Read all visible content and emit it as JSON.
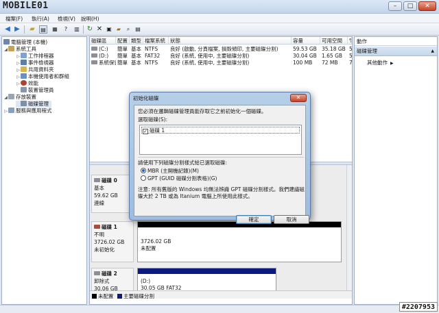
{
  "window": {
    "logo_text": "MOBILE01"
  },
  "menu": [
    "檔案(F)",
    "執行(A)",
    "檢視(V)",
    "說明(H)"
  ],
  "tree": [
    {
      "label": "電腦管理 (本機)",
      "depth": 0,
      "icon": "computer-icon"
    },
    {
      "label": "系統工具",
      "depth": 1,
      "icon": "tools-icon"
    },
    {
      "label": "工作排程器",
      "depth": 2,
      "icon": "task-scheduler-icon"
    },
    {
      "label": "事件檢視器",
      "depth": 2,
      "icon": "event-viewer-icon"
    },
    {
      "label": "共用資料夾",
      "depth": 2,
      "icon": "shared-folder-icon"
    },
    {
      "label": "本機使用者和群組",
      "depth": 2,
      "icon": "users-groups-icon"
    },
    {
      "label": "效能",
      "depth": 2,
      "icon": "performance-icon"
    },
    {
      "label": "裝置管理員",
      "depth": 2,
      "icon": "device-manager-icon"
    },
    {
      "label": "存放裝置",
      "depth": 1,
      "icon": "storage-icon"
    },
    {
      "label": "磁碟管理",
      "depth": 2,
      "icon": "disk-management-icon"
    },
    {
      "label": "服務與應用程式",
      "depth": 1,
      "icon": "services-icon"
    }
  ],
  "volumes": {
    "headers": [
      "磁碟區",
      "配置",
      "類型",
      "檔案系統",
      "狀態",
      "容量",
      "可用空間",
      "%"
    ],
    "rows": [
      [
        "(C:)",
        "簡單",
        "基本",
        "NTFS",
        "良好 (啟動, 分頁檔案, 損毀傾印, 主要磁碟分割)",
        "59.53 GB",
        "35.18 GB",
        "5"
      ],
      [
        "(D:)",
        "簡單",
        "基本",
        "FAT32",
        "良好 (系統, 使用中, 主要磁碟分割)",
        "30.04 GB",
        "1.65 GB",
        "5"
      ],
      [
        "系統保留",
        "簡單",
        "基本",
        "NTFS",
        "良好 (系統, 使用中, 主要磁碟分割)",
        "100 MB",
        "72 MB",
        "7"
      ]
    ]
  },
  "disks": [
    {
      "name": "磁碟 0",
      "type": "基本",
      "size": "59.62 GB",
      "status": "連線",
      "partition": ""
    },
    {
      "name": "磁碟 1",
      "type": "不明",
      "size": "3726.02 GB",
      "status": "未初始化",
      "partition": "3726.02 GB",
      "partition_status": "未配置"
    },
    {
      "name": "磁碟 2",
      "type": "卸除式",
      "size": "30.06 GB",
      "status": "",
      "partition": "(D:)",
      "partition_detail": "30.05 GB FAT32"
    }
  ],
  "legend": [
    {
      "label": "未配置",
      "color": "#000000"
    },
    {
      "label": "主要磁碟分割",
      "color": "#0a1a80"
    }
  ],
  "actions": {
    "header": "動作",
    "section": "磁碟管理",
    "more": "其他動作"
  },
  "dialog": {
    "title": "初始化磁碟",
    "intro": "您必須在邏輯磁碟管理員能存取它之前初始化一個磁碟。",
    "select_label": "選取磁碟(S):",
    "disk_item": "磁碟 1",
    "style_label": "請使用下列磁碟分割樣式給已選取磁碟:",
    "option_mbr": "MBR (主開機記錄)(M)",
    "option_gpt": "GPT (GUID 磁碟分割表格)(G)",
    "note_line1": "注意: 所有舊版的 Windows 均無法辨識 GPT 磁碟分割樣式。我們建議磁",
    "note_line2": "碟大於 2 TB 或為 Itanium 電腦上所使用此樣式。",
    "ok": "確定",
    "cancel": "取消"
  },
  "watermark": "#2207953"
}
